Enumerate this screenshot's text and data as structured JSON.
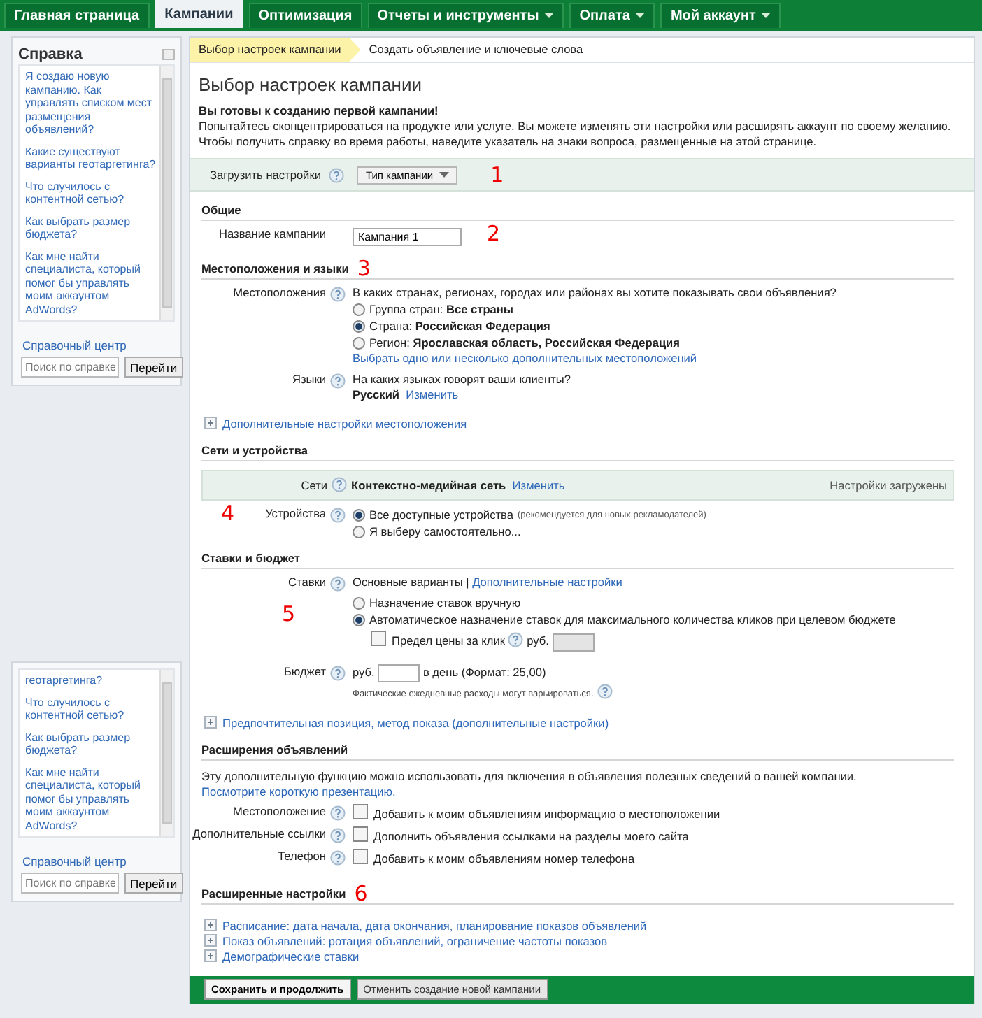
{
  "nav": {
    "tabs": [
      {
        "label": "Главная страница",
        "selected": false,
        "dropdown": false
      },
      {
        "label": "Кампании",
        "selected": true,
        "dropdown": false
      },
      {
        "label": "Оптимизация",
        "selected": false,
        "dropdown": false
      },
      {
        "label": "Отчеты и инструменты",
        "selected": false,
        "dropdown": true
      },
      {
        "label": "Оплата",
        "selected": false,
        "dropdown": true
      },
      {
        "label": "Мой аккаунт",
        "selected": false,
        "dropdown": true
      }
    ]
  },
  "help_panels": [
    {
      "title": "Справка",
      "items": [
        "Я создаю новую кампанию. Как управлять списком мест размещения объявлений?",
        "Какие существуют варианты геотаргетинга?",
        "Что случилось с контентной сетью?",
        "Как выбрать размер бюджета?",
        "Как мне найти специалиста, который помог бы управлять моим аккаунтом AdWords?"
      ],
      "help_center": "Справочный центр",
      "search_placeholder": "Поиск по справке",
      "search_button": "Перейти"
    },
    {
      "items": [
        "геотаргетинга?",
        "Что случилось с контентной сетью?",
        "Как выбрать размер бюджета?",
        "Как мне найти специалиста, который помог бы управлять моим аккаунтом AdWords?"
      ],
      "help_center": "Справочный центр",
      "search_placeholder": "Поиск по справке",
      "search_button": "Перейти"
    }
  ],
  "steps": [
    {
      "label": "Выбор настроек кампании",
      "selected": true
    },
    {
      "label": "Создать объявление и ключевые слова",
      "selected": false
    }
  ],
  "title": "Выбор настроек кампании",
  "intro": {
    "heading": "Вы готовы к созданию первой кампании!",
    "text": "Попытайтесь сконцентрироваться на продукте или услуге. Вы можете изменять эти настройки или расширять аккаунт по своему желанию. Чтобы получить справку во время работы, наведите указатель на знаки вопроса, размещенные на этой странице."
  },
  "load_settings": {
    "label": "Загрузить настройки",
    "button": "Тип кампании",
    "annotation": "1"
  },
  "general": {
    "heading": "Общие",
    "name_label": "Название кампании",
    "name_value": "Кампания 1",
    "annotation": "2"
  },
  "locations": {
    "heading": "Местоположения и языки",
    "annotation": "3",
    "label": "Местоположения",
    "question": "В каких странах, регионах, городах или районах вы хотите показывать свои объявления?",
    "options": [
      {
        "label": "Группа стран: **Все страны**",
        "selected": false
      },
      {
        "label": "Страна: **Российская Федерация**",
        "selected": true
      },
      {
        "label": "Регион: **Ярославская область, Российская Федерация**",
        "selected": false
      }
    ],
    "more_link": "Выбрать одно или несколько дополнительных местоположений",
    "languages_label": "Языки",
    "languages_question": "На каких языках говорят ваши клиенты?",
    "language": "Русский",
    "change_link": "Изменить",
    "advanced_link": "Дополнительные настройки местоположения"
  },
  "networks": {
    "heading": "Сети и устройства",
    "networks_label": "Сети",
    "network": "Контекстно-медийная сеть",
    "change_link": "Изменить",
    "status": "Настройки загружены",
    "devices_label": "Устройства",
    "annotation": "4",
    "device_options": [
      {
        "label": "Все доступные устройства",
        "note": "(рекомендуется для новых рекламодателей)",
        "selected": true
      },
      {
        "label": "Я выберу самостоятельно...",
        "selected": false
      }
    ]
  },
  "bidding": {
    "heading": "Ставки и бюджет",
    "bids_label": "Ставки",
    "basic": "Основные варианты",
    "separator": "|",
    "advanced_link": "Дополнительные настройки",
    "annotation": "5",
    "options": [
      {
        "label": "Назначение ставок вручную",
        "selected": false
      },
      {
        "label": "Автоматическое назначение ставок для максимального количества кликов при целевом бюджете",
        "selected": true
      }
    ],
    "cpc_limit": {
      "label": "Предел цены за клик",
      "checked": false,
      "currency": "руб."
    },
    "budget_label": "Бюджет",
    "budget_currency": "руб.",
    "budget_suffix": "в день (Формат: 25,00)",
    "budget_note": "Фактические ежедневные расходы могут варьироваться.",
    "position_link": "Предпочтительная позиция, метод показа (дополнительные настройки)"
  },
  "extensions": {
    "heading": "Расширения объявлений",
    "text": "Эту дополнительную функцию можно использовать для включения в объявления полезных сведений о вашей компании.",
    "link": "Посмотрите короткую презентацию.",
    "rows": [
      {
        "label": "Местоположение",
        "option": "Добавить к моим объявлениям информацию о местоположении",
        "checked": false
      },
      {
        "label": "Дополнительные ссылки",
        "option": "Дополнить объявления ссылками на разделы моего сайта",
        "checked": false
      },
      {
        "label": "Телефон",
        "option": "Добавить к моим объявлениям номер телефона",
        "checked": false
      }
    ]
  },
  "advanced": {
    "heading": "Расширенные настройки",
    "annotation": "6",
    "links": [
      "Расписание: дата начала, дата окончания, планирование показов объявлений",
      "Показ объявлений: ротация объявлений, ограничение частоты показов",
      "Демографические ставки"
    ]
  },
  "footer": {
    "buttons": [
      {
        "label": "Сохранить и продолжить",
        "kind": "primary"
      },
      {
        "label": "Отменить создание новой кампании",
        "kind": "secondary"
      }
    ]
  }
}
